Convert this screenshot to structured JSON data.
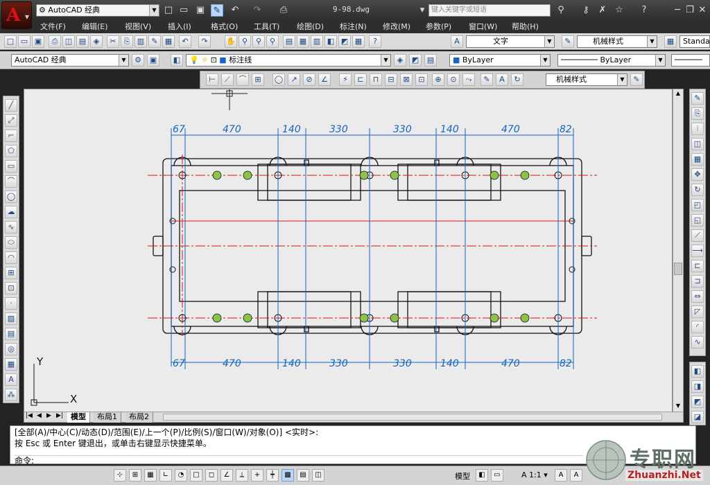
{
  "titlebar": {
    "workspace": "AutoCAD 经典",
    "doc_title": "9-98.dwg",
    "search_placeholder": "键入关键字或短语",
    "quick_access": [
      "new-icon",
      "open-icon",
      "save-icon",
      "saveas-icon",
      "undo-icon",
      "redo-icon",
      "print-icon"
    ]
  },
  "menubar": [
    "文件(F)",
    "编辑(E)",
    "视图(V)",
    "插入(I)",
    "格式(O)",
    "工具(T)",
    "绘图(D)",
    "标注(N)",
    "修改(M)",
    "参数(P)",
    "窗口(W)",
    "帮助(H)"
  ],
  "toolbar1": {
    "text_style": "文字",
    "dim_style": "机械样式",
    "table_style": "Standa"
  },
  "toolbar2": {
    "workspace": "AutoCAD 经典",
    "layer": "标注线",
    "color": "ByLayer",
    "linetype": "ByLayer"
  },
  "toolbar3": {
    "dim_style": "机械样式"
  },
  "drawing": {
    "top_dims": [
      "67",
      "470",
      "140",
      "330",
      "330",
      "140",
      "470",
      "82"
    ],
    "bottom_dims": [
      "67",
      "470",
      "140",
      "330",
      "330",
      "140",
      "470",
      "82"
    ],
    "ucs_x": "X",
    "ucs_y": "Y"
  },
  "layout_tabs": [
    "模型",
    "布局1",
    "布局2"
  ],
  "command": {
    "line1": "[全部(A)/中心(C)/动态(D)/范围(E)/上一个(P)/比例(S)/窗口(W)/对象(O)] <实时>:",
    "line2": "按 Esc 或 Enter 键退出，或单击右键显示快捷菜单。",
    "prompt": "命令:"
  },
  "status": {
    "space": "模型",
    "scale": "1:1"
  },
  "watermark": {
    "brand": "专职网",
    "url": "Zhuanzhi.Net"
  },
  "colors": {
    "center_line": "#e01010",
    "dimension": "#1565c0",
    "outline": "#111111"
  }
}
